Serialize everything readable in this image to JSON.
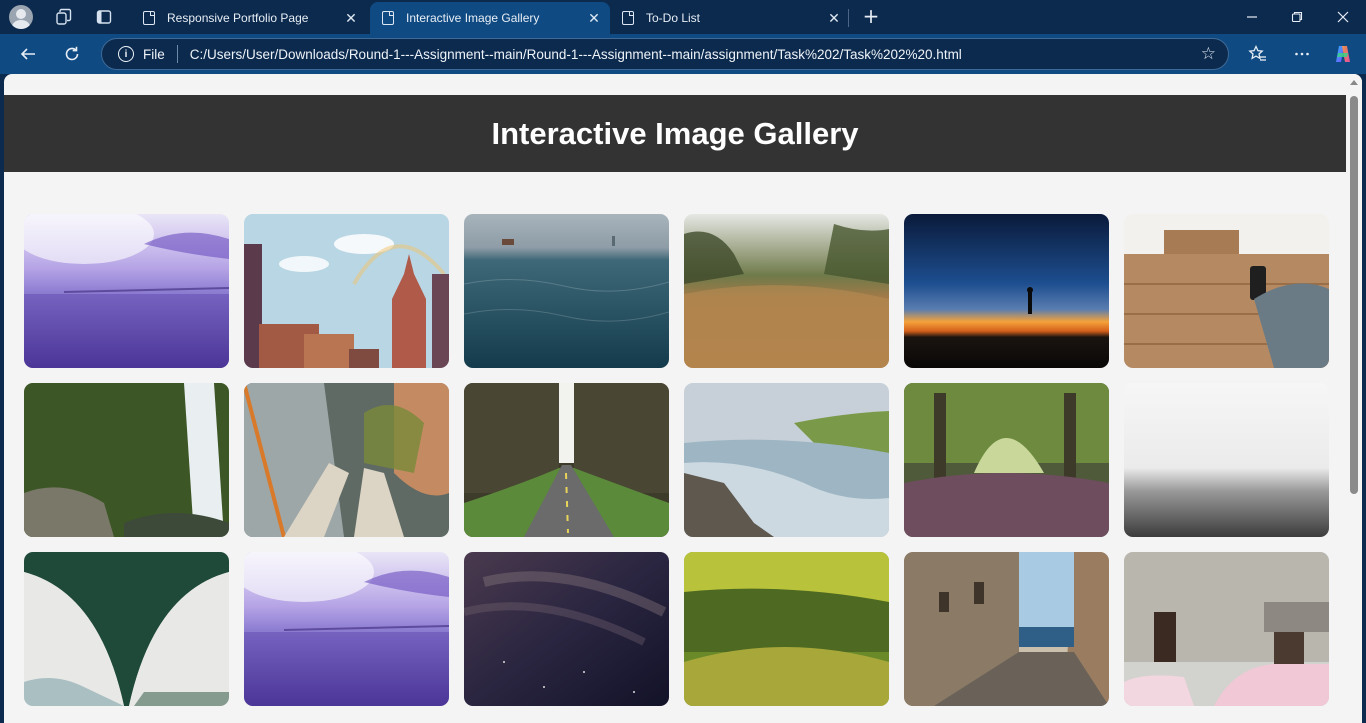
{
  "browser": {
    "tabs": [
      {
        "title": "Responsive Portfolio Page",
        "active": false
      },
      {
        "title": "Interactive Image Gallery",
        "active": true
      },
      {
        "title": "To-Do List",
        "active": false
      }
    ],
    "address": {
      "scheme_label": "File",
      "url": "C:/Users/User/Downloads/Round-1---Assignment--main/Round-1---Assignment--main/assignment/Task%202/Task%202%20.html"
    },
    "accent": "#0f4a82",
    "frame": "#0c2a4e"
  },
  "page": {
    "title": "Interactive Image Gallery",
    "header_bg": "#333333",
    "body_bg": "#f4f4f4"
  },
  "gallery": {
    "columns": 6,
    "images": [
      {
        "subject": "purple sky over sea with bridge"
      },
      {
        "subject": "city skyscrapers with rainbow"
      },
      {
        "subject": "ocean with ship and statue of liberty"
      },
      {
        "subject": "golden grass field"
      },
      {
        "subject": "silhouette at sunset"
      },
      {
        "subject": "wooden table with phone in hand"
      },
      {
        "subject": "waterfall in forest"
      },
      {
        "subject": "feet above city buildings"
      },
      {
        "subject": "road through pine forest"
      },
      {
        "subject": "rushing waterfall river"
      },
      {
        "subject": "green tree tunnel path"
      },
      {
        "subject": "foggy grey sea"
      },
      {
        "subject": "underside of bridge"
      },
      {
        "subject": "purple sky over sea with bridge"
      },
      {
        "subject": "starry night sky"
      },
      {
        "subject": "mossy hill with flowers"
      },
      {
        "subject": "narrow alley to sea"
      },
      {
        "subject": "old building with pink car"
      }
    ]
  }
}
